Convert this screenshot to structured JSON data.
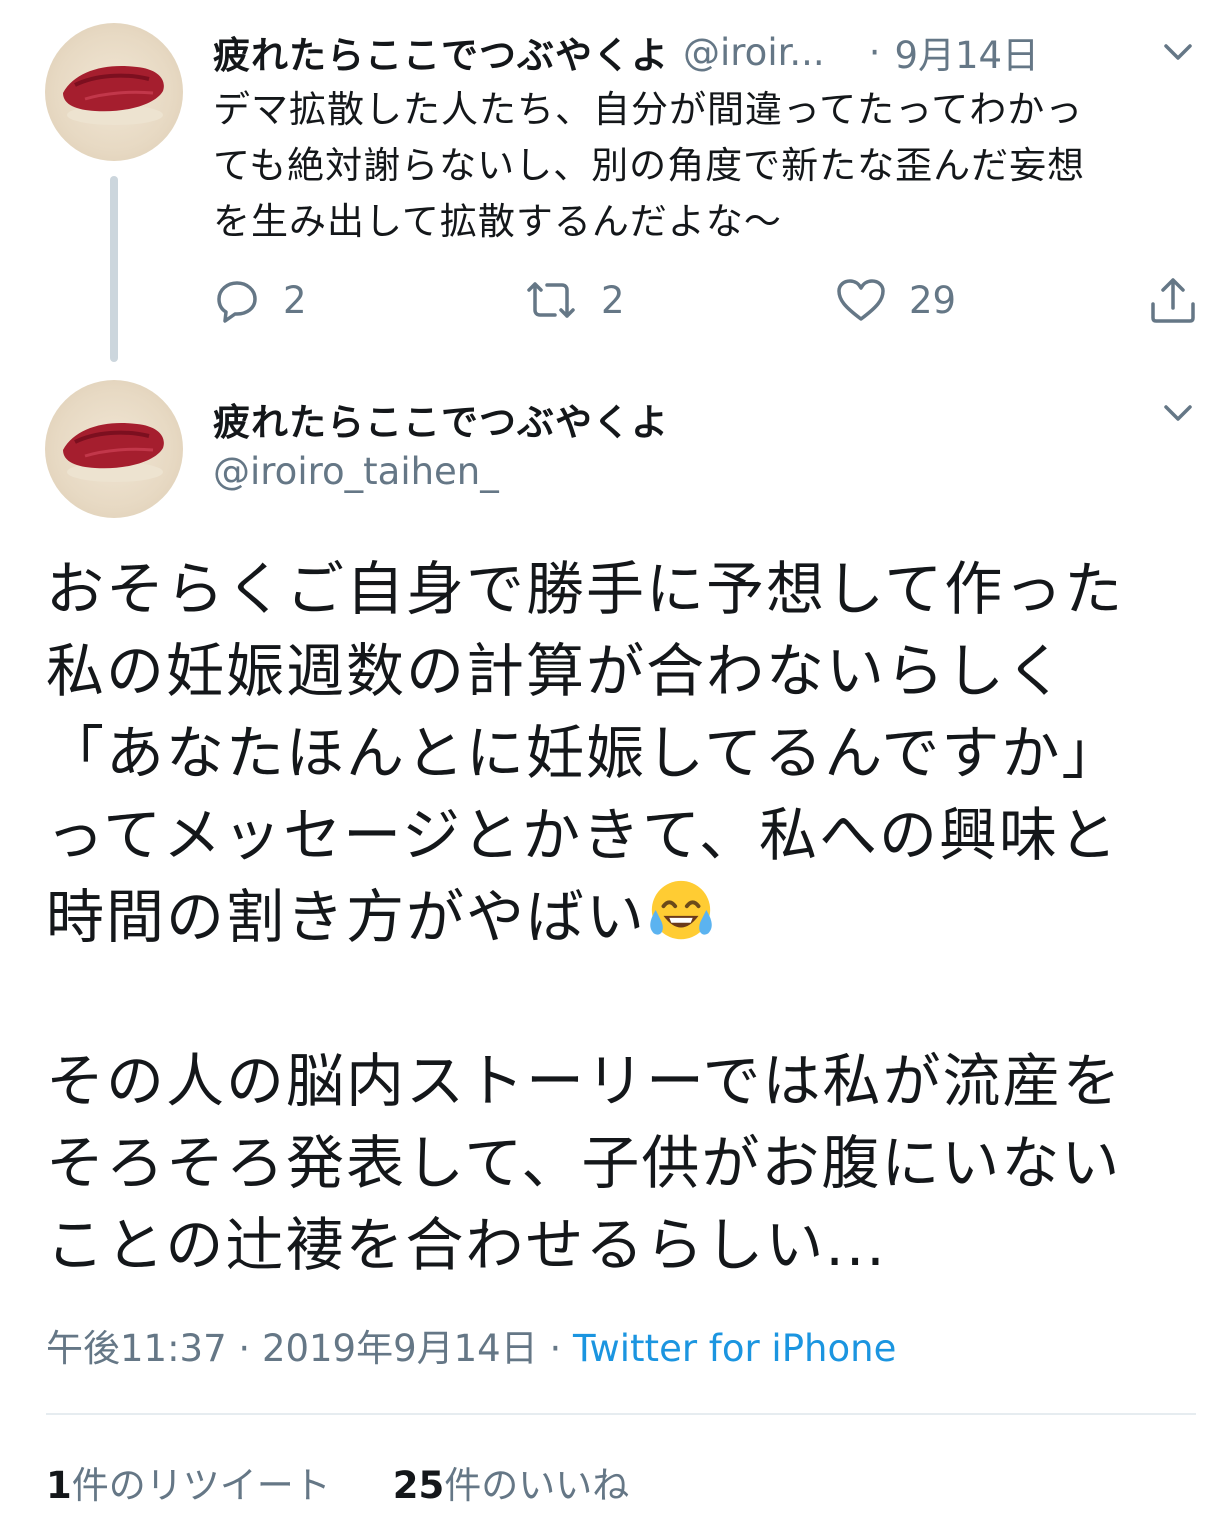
{
  "parent_tweet": {
    "display_name": "疲れたらここでつぶやくよ",
    "handle_truncated": "@iroir...",
    "separator": "·",
    "date": "9月14日",
    "text": "デマ拡散した人たち、自分が間違ってたってわかっ\nても絶対謝らないし、別の角度で新たな歪んだ妄想\nを生み出して拡散するんだよな〜",
    "reply_count": "2",
    "retweet_count": "2",
    "like_count": "29",
    "icons": {
      "more": "chevron-down-icon",
      "reply": "reply-bubble-icon",
      "retweet": "retweet-icon",
      "like": "heart-icon",
      "share": "share-icon"
    }
  },
  "main_tweet": {
    "display_name": "疲れたらここでつぶやくよ",
    "handle": "@iroiro_taihen_",
    "paragraph1": "おそらくご自身で勝手に予想して作った\n私の妊娠週数の計算が合わないらしく\n「あなたほんとに妊娠してるんですか」\nってメッセージとかきて、私への興味と\n時間の割き方がやばい",
    "emoji": "face-with-tears-of-joy",
    "paragraph2": "その人の脳内ストーリーでは私が流産を\nそろそろ発表して、子供がお腹にいない\nことの辻褄を合わせるらしい...",
    "time": "午後11:37",
    "date": "2019年9月14日",
    "meta_separator": "·",
    "source": "Twitter for iPhone",
    "retweets_count": "1",
    "retweets_label": "件のリツイート",
    "likes_count": "25",
    "likes_label": "件のいいね"
  },
  "colors": {
    "text": "#14171a",
    "secondary": "#657786",
    "link": "#1b95e0",
    "thread_line": "#ccd6dd",
    "divider": "#e6ecf0"
  }
}
